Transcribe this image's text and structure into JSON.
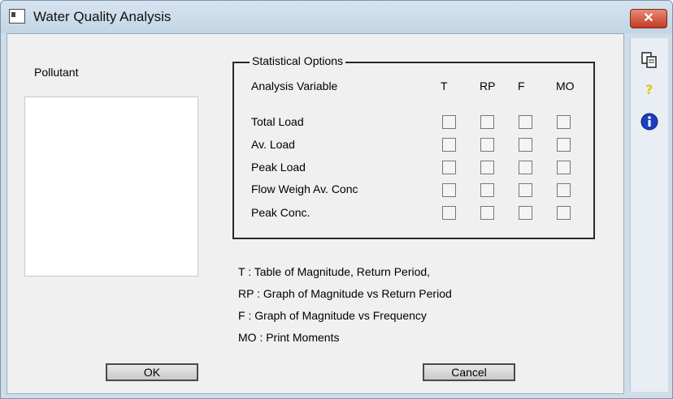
{
  "window": {
    "title": "Water Quality Analysis",
    "close_symbol": "✕"
  },
  "pollutant": {
    "label": "Pollutant",
    "items": []
  },
  "statistical_options": {
    "title": "Statistical Options",
    "variable_header": "Analysis Variable",
    "columns": [
      "T",
      "RP",
      "F",
      "MO"
    ],
    "rows": [
      {
        "label": "Total Load",
        "checked": [
          false,
          false,
          false,
          false
        ]
      },
      {
        "label": "Av. Load",
        "checked": [
          false,
          false,
          false,
          false
        ]
      },
      {
        "label": "Peak Load",
        "checked": [
          false,
          false,
          false,
          false
        ]
      },
      {
        "label": "Flow Weigh Av. Conc",
        "checked": [
          false,
          false,
          false,
          false
        ]
      },
      {
        "label": "Peak Conc.",
        "checked": [
          false,
          false,
          false,
          false
        ]
      }
    ]
  },
  "legend": [
    "T : Table of Magnitude, Return Period,",
    "RP : Graph of Magnitude vs Return Period",
    "F : Graph of Magnitude vs Frequency",
    "MO : Print Moments"
  ],
  "buttons": {
    "ok": "OK",
    "cancel": "Cancel"
  },
  "sidebar": {
    "icons": [
      "copy-icon",
      "help-icon",
      "info-icon"
    ],
    "help_color": "#e8c400",
    "info_color": "#1a3fc0"
  }
}
